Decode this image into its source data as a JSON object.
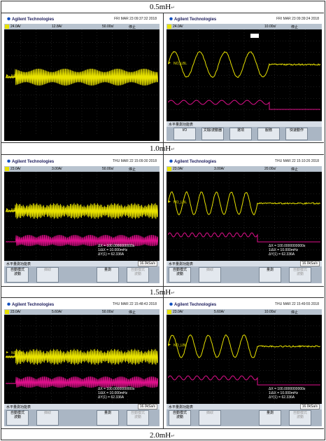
{
  "headers": [
    "0.5mH",
    "1.0mH",
    "1.5mH",
    "2.0mH"
  ],
  "header_mark": "↵",
  "brand": "Agilent Technologies",
  "channel_label": "NO_LBL",
  "panels": [
    {
      "id": "p1",
      "date": "FRI MAR 23 09:37:32 2018",
      "ch1": "24.0A/",
      "ch2": "12.8A/",
      "time": "50.00s/",
      "mode": "停止",
      "menu_title": "",
      "softkeys": [],
      "meas": [],
      "rate": ""
    },
    {
      "id": "p2",
      "date": "FRI MAR 23 09:39:24 2018",
      "ch1": "24.0A/",
      "ch2": "",
      "time": "10.00s/",
      "mode": "停止",
      "menu_title": "水平量測功能表",
      "softkeys": [
        "I/O",
        "文檔/波動器",
        "選項",
        "服務",
        "快速動作"
      ],
      "meas": [],
      "rate": ""
    },
    {
      "id": "p3",
      "date": "THU MAR 22 15:09:30 2018",
      "ch1": "23.0A/",
      "ch2": "3.00A/",
      "time": "50.00s/",
      "mode": "停止",
      "menu_title": "水平量測功能表",
      "softkeys": [
        "自動模式\n波動",
        "擷取",
        "",
        "量測",
        "自動模式\n波動"
      ],
      "meas": [
        "ΔX = 100.0000000000s",
        "1/ΔX = 10.000mHz",
        "ΔY(1) = 62.336A"
      ],
      "rate": "16.0kSa/s"
    },
    {
      "id": "p4",
      "date": "THU MAR 22 15:10:26 2018",
      "ch1": "23.0A/",
      "ch2": "3.00A/",
      "time": "20.00s/",
      "mode": "停止",
      "menu_title": "水平量測功能表",
      "softkeys": [
        "自動模式\n波動",
        "擷取",
        "",
        "量測",
        "自動模式\n波動"
      ],
      "meas": [
        "ΔX = 100.0000000000s",
        "1/ΔX = 10.000mHz",
        "ΔY(1) = 62.336A"
      ],
      "rate": "16.0kSa/s"
    },
    {
      "id": "p5",
      "date": "THU MAR 22 15:48:43 2018",
      "ch1": "23.0A/",
      "ch2": "5.60A/",
      "time": "50.00s/",
      "mode": "停止",
      "menu_title": "水平量測功能表",
      "softkeys": [
        "自動模式\n波動",
        "擷取",
        "",
        "量測",
        "自動模式\n波動"
      ],
      "meas": [
        "ΔX = 100.0000000000s",
        "1/ΔX = 10.000mHz",
        "ΔY(1) = 62.336A"
      ],
      "rate": "16.0kSa/s"
    },
    {
      "id": "p6",
      "date": "THU MAR 22 15:49:55 2018",
      "ch1": "23.0A/",
      "ch2": "5.60A/",
      "time": "10.00s/",
      "mode": "停止",
      "menu_title": "水平量測功能表",
      "softkeys": [
        "自動模式\n波動",
        "擷取",
        "",
        "量測",
        "自動模式\n波動"
      ],
      "meas": [
        "ΔX = 100.0000000000s",
        "1/ΔX = 10.000mHz",
        "ΔY(1) = 62.336A"
      ],
      "rate": "16.0kSa/s"
    }
  ],
  "colors": {
    "ch1": "#e8e200",
    "ch2": "#e0108c",
    "grid": "#3a3a3a"
  }
}
